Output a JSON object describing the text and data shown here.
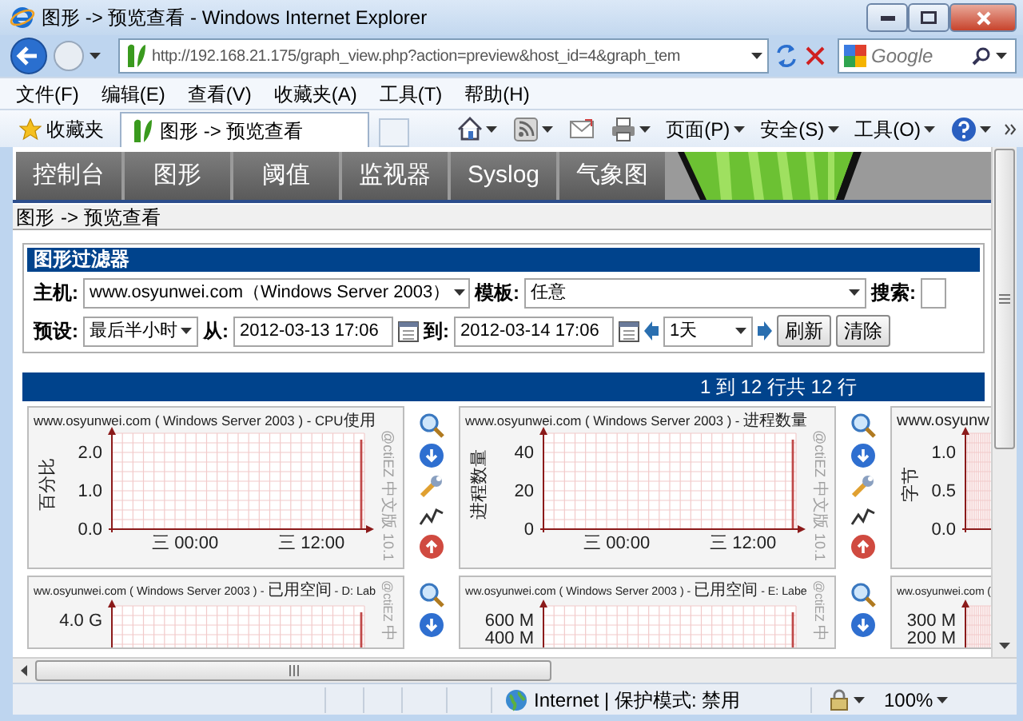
{
  "window": {
    "title": "图形 -> 预览查看 - Windows Internet Explorer"
  },
  "address_bar": {
    "url": "http://192.168.21.175/graph_view.php?action=preview&host_id=4&graph_tem",
    "search_placeholder": "Google"
  },
  "menu_bar": [
    "文件(F)",
    "编辑(E)",
    "查看(V)",
    "收藏夹(A)",
    "工具(T)",
    "帮助(H)"
  ],
  "favorites_bar": {
    "favorites_button": "收藏夹",
    "tab": "图形 -> 预览查看"
  },
  "command_bar": [
    "页面(P)",
    "安全(S)",
    "工具(O)"
  ],
  "nav_tabs": [
    "控制台",
    "图形",
    "阈值",
    "监视器",
    "Syslog",
    "气象图"
  ],
  "breadcrumb": {
    "link": "图形",
    "current": "-> 预览查看"
  },
  "filter": {
    "title": "图形过滤器",
    "rows": [
      {
        "items": [
          {
            "kind": "label",
            "text": "主机:"
          },
          {
            "kind": "select",
            "text": "www.osyunwei.com（Windows Server 2003）"
          },
          {
            "kind": "label",
            "text": "模板:"
          },
          {
            "kind": "select",
            "text": "任意"
          },
          {
            "kind": "label",
            "text": "搜索:"
          },
          {
            "kind": "input"
          }
        ]
      },
      {
        "items": [
          {
            "kind": "label",
            "text": "预设:"
          },
          {
            "kind": "select",
            "text": "最后半小时"
          },
          {
            "kind": "label",
            "text": "从:"
          },
          {
            "kind": "input",
            "text": "2012-03-13 17:06"
          },
          {
            "kind": "calendar"
          },
          {
            "kind": "label",
            "text": "到:"
          },
          {
            "kind": "input",
            "text": "2012-03-14 17:06"
          },
          {
            "kind": "calendar"
          },
          {
            "kind": "prev"
          },
          {
            "kind": "select",
            "text": "1天"
          },
          {
            "kind": "next"
          },
          {
            "kind": "button",
            "text": "刷新"
          },
          {
            "kind": "button",
            "text": "清除"
          }
        ]
      }
    ]
  },
  "results_bar": "1 到 12 行共 12 行",
  "graph_rows": [
    {
      "cut_off": false,
      "graphs": [
        {
          "title": "www.osyunwei.com ( Windows Server 2003 ) - CPU使用",
          "ylabel": "百分比",
          "y_labels": [
            "2.0",
            "1.0",
            "0.0"
          ],
          "x_labels": [
            "三 00:00",
            "三 12:00"
          ],
          "side_text": "@ctiEZ 中文版 10.1"
        },
        {
          "title": "www.osyunwei.com ( Windows Server 2003 ) - 进程数量",
          "ylabel": "进程数量",
          "y_labels": [
            "40",
            "20",
            "0"
          ],
          "x_labels": [
            "三 00:00",
            "三 12:00"
          ],
          "side_text": "@ctiEZ 中文版 10.1"
        },
        {
          "title": "www.osyunw",
          "ylabel": "字节",
          "y_labels": [
            "1.0",
            "0.5",
            "0.0"
          ]
        }
      ]
    },
    {
      "cut_off": true,
      "graphs": [
        {
          "title": "ww.osyunwei.com ( Windows Server 2003 ) - 已用空间 - D: Lab",
          "y_labels": [
            "4.0 G"
          ],
          "side_text": "@ctiEZ 中"
        },
        {
          "title": "ww.osyunwei.com ( Windows Server 2003 ) - 已用空间 - E: Labe",
          "y_labels": [
            "600 M",
            "400 M"
          ],
          "side_text": "@ctiEZ 中"
        },
        {
          "title": "ww.osyunwei.com (",
          "y_labels": [
            "300 M",
            "200 M"
          ]
        }
      ]
    }
  ],
  "status_bar": {
    "zone": "Internet | 保护模式: 禁用",
    "zoom": "100%"
  }
}
